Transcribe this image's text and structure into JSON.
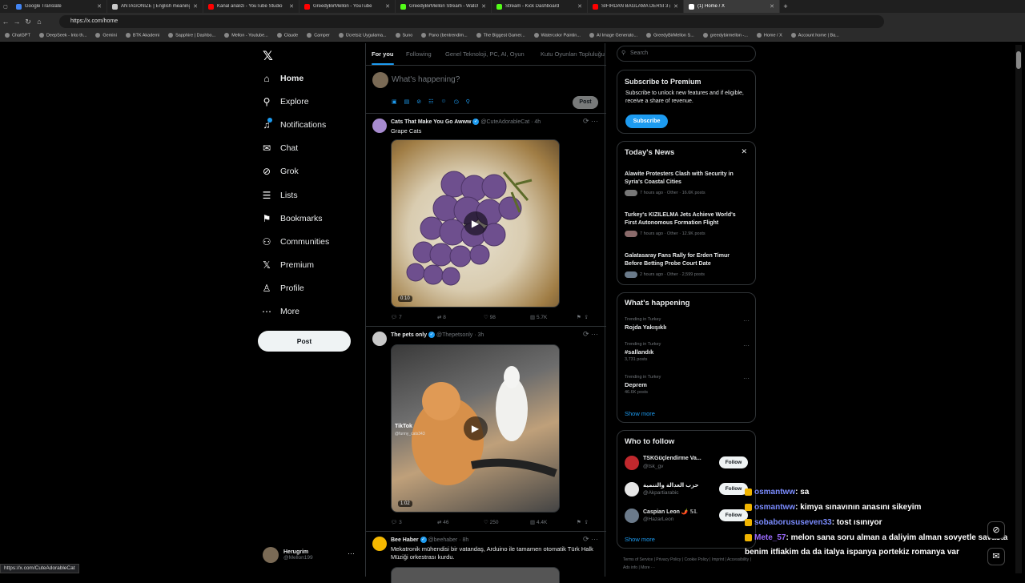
{
  "browser": {
    "tabs": [
      {
        "label": "Google Translate",
        "color": "#4285f4"
      },
      {
        "label": "ANTAGONIZE | English meaning -",
        "color": "#c9c9c9"
      },
      {
        "label": "Kanal analizi - YouTube Studio",
        "color": "#ff0000"
      },
      {
        "label": "GreedyBirMellon - YouTube",
        "color": "#ff0000"
      },
      {
        "label": "GreedyBirMellon Stream - Watch",
        "color": "#53fc18"
      },
      {
        "label": "Stream - Kick Dashboard",
        "color": "#53fc18"
      },
      {
        "label": "SIFIRDAN BAĞLAMA DERSİ 3 (EN",
        "color": "#ff0000"
      },
      {
        "label": "(1) Home / X",
        "color": "#ffffff"
      }
    ],
    "url": "https://x.com/home",
    "bookmarks": [
      "ChatGPT",
      "DeepSeek - Into th...",
      "Gemini",
      "BTK Akademi",
      "Sapphire | Dashbo...",
      "Mellon - Youtube...",
      "Claude",
      "Camper",
      "Ücretsiz Uygulama...",
      "Suno",
      "Pano (bentrendim...",
      "The Biggest Gamer...",
      "Watercolor Paintin...",
      "AI Image Generato...",
      "GreedyBirMellon S...",
      "greedybirmellon -...",
      "Home / X",
      "Account home | Ba..."
    ],
    "status_url": "https://x.com/CuteAdorableCat"
  },
  "nav": {
    "logo": "𝕏",
    "items": [
      {
        "label": "Home",
        "icon": "home-icon",
        "glyph": "⌂"
      },
      {
        "label": "Explore",
        "icon": "search-icon",
        "glyph": "⚲"
      },
      {
        "label": "Notifications",
        "icon": "bell-icon",
        "glyph": "♫"
      },
      {
        "label": "Chat",
        "icon": "envelope-icon",
        "glyph": "✉"
      },
      {
        "label": "Grok",
        "icon": "grok-icon",
        "glyph": "⊘"
      },
      {
        "label": "Lists",
        "icon": "list-icon",
        "glyph": "☰"
      },
      {
        "label": "Bookmarks",
        "icon": "bookmark-icon",
        "glyph": "⚑"
      },
      {
        "label": "Communities",
        "icon": "people-icon",
        "glyph": "⚇"
      },
      {
        "label": "Premium",
        "icon": "x-icon",
        "glyph": "𝕏"
      },
      {
        "label": "Profile",
        "icon": "person-icon",
        "glyph": "♙"
      },
      {
        "label": "More",
        "icon": "more-circle-icon",
        "glyph": "⋯"
      }
    ],
    "post_label": "Post",
    "account": {
      "name": "Herugrim",
      "handle": "@Mellon199"
    }
  },
  "feed": {
    "tabs": [
      "For you",
      "Following",
      "Genel Teknoloji, PC, AI, Oyun",
      "Kutu Oyunları Topluluğu"
    ],
    "compose_placeholder": "What's happening?",
    "compose_post": "Post",
    "tweets": [
      {
        "name": "Cats That Make You Go Awww",
        "handle": "@CuteAdorableCat · 4h",
        "text": "Grape Cats",
        "duration": "0:10",
        "replies": "7",
        "reposts": "8",
        "likes": "98",
        "views": "5.7K"
      },
      {
        "name": "The pets only",
        "handle": "@Thepetsonly · 3h",
        "text": "",
        "duration": "1:02",
        "watermark": "TikTok",
        "watermark_handle": "@funny_cats343",
        "replies": "3",
        "reposts": "46",
        "likes": "250",
        "views": "4.4K"
      },
      {
        "name": "Bee Haber",
        "handle": "@beehaber · 8h",
        "text": "Mekatronik mühendisi bir vatandaş, Arduino ile tamamen otomatik Türk Halk Müziği orkestrası kurdu."
      }
    ]
  },
  "sidebar": {
    "search_placeholder": "Search",
    "premium": {
      "title": "Subscribe to Premium",
      "body": "Subscribe to unlock new features and if eligible, receive a share of revenue.",
      "button": "Subscribe"
    },
    "news": {
      "title": "Today's News",
      "items": [
        {
          "title": "Alawite Protesters Clash with Security in Syria's Coastal Cities",
          "meta": "7 hours ago · Other · 16.6K posts"
        },
        {
          "title": "Turkey's KIZILELMA Jets Achieve World's First Autonomous Formation Flight",
          "meta": "7 hours ago · Other · 12.9K posts"
        },
        {
          "title": "Galatasaray Fans Rally for Erden Timur Before Betting Probe Court Date",
          "meta": "2 hours ago · Other · 2,599 posts"
        }
      ]
    },
    "happening": {
      "title": "What's happening",
      "items": [
        {
          "context": "Trending in Turkey",
          "name": "Rojda Yakışıklı",
          "count": ""
        },
        {
          "context": "Trending in Turkey",
          "name": "#sallandık",
          "count": "3,731 posts"
        },
        {
          "context": "Trending in Turkey",
          "name": "Deprem",
          "count": "46.6K posts"
        }
      ],
      "show_more": "Show more"
    },
    "follow": {
      "title": "Who to follow",
      "items": [
        {
          "name": "TSKGüçlendirme Va...",
          "handle": "@tsk_gv",
          "button": "Follow"
        },
        {
          "name": "حزب العدالة والتنمية",
          "handle": "@Akpartiarabic",
          "button": "Follow"
        },
        {
          "name": "Caspian Leon 🌶️ 𝕊𝕃",
          "handle": "@HazarLeon",
          "button": "Follow"
        }
      ],
      "show_more": "Show more"
    },
    "footer": "Terms of Service  |  Privacy Policy  |  Cookie Policy  |  Imprint  |  Accessibility  |  Ads info  |  More ···"
  },
  "chat": [
    {
      "user": "osmantww",
      "msg": ": sa"
    },
    {
      "user": "osmantww",
      "msg": ": kimya sınavının anasını sikeyim"
    },
    {
      "user": "sobaborususeven33",
      "msg": ": tost ısınıyor"
    },
    {
      "user": "Mete_57",
      "msg": ": melon sana soru alman a daliyim alman sovyetle savasta"
    },
    {
      "user": "",
      "msg": "benim itfiakim da da italya ispanya portekiz romanya var"
    }
  ]
}
